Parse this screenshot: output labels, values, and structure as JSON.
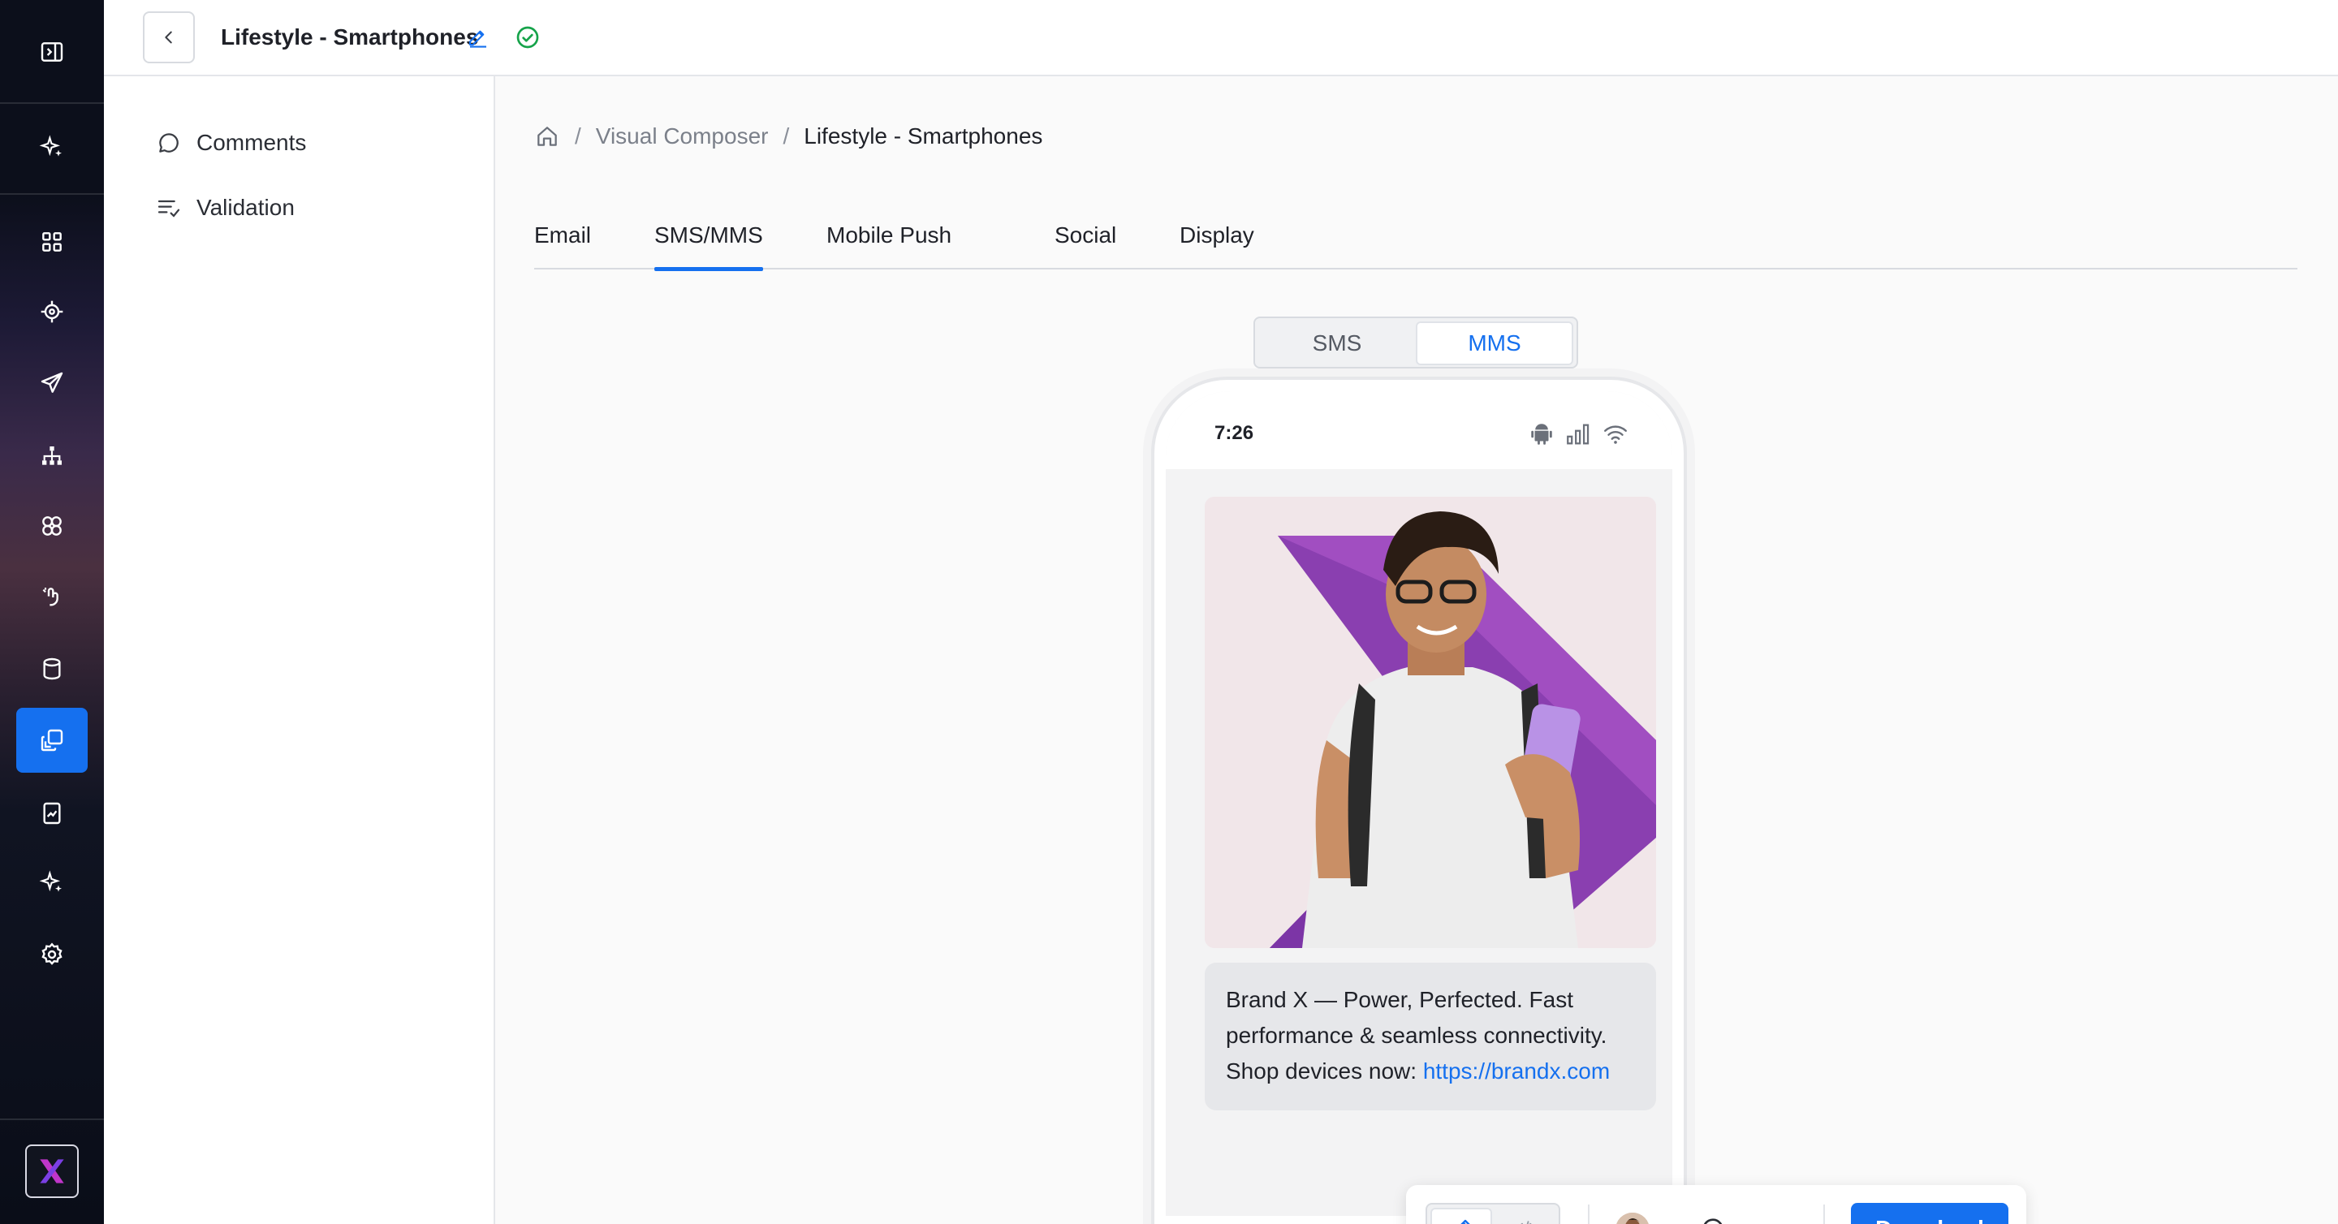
{
  "topbar": {
    "title": "Lifestyle - Smartphones"
  },
  "left_panel": {
    "items": [
      {
        "label": "Comments",
        "icon": "comment-icon"
      },
      {
        "label": "Validation",
        "icon": "checklist-icon"
      }
    ]
  },
  "breadcrumb": {
    "sep1": "/",
    "sep2": "/",
    "parent": "Visual Composer",
    "current": "Lifestyle - Smartphones"
  },
  "tabs": [
    {
      "label": "Email"
    },
    {
      "label": "SMS/MMS",
      "active": true
    },
    {
      "label": "Mobile Push"
    },
    {
      "label": "Social"
    },
    {
      "label": "Display"
    }
  ],
  "message_type": {
    "options": [
      "SMS",
      "MMS"
    ],
    "selected": "MMS"
  },
  "phone": {
    "time": "7:26",
    "message_text": "Brand X — Power, Perfected. Fast performance & seamless connectivity. Shop devices now: ",
    "message_link": "https://brandx.com"
  },
  "toolbar": {
    "download_label": "Download"
  },
  "colors": {
    "accent": "#1570ef",
    "success": "#16a34a",
    "rail_active": "#1570ef"
  }
}
